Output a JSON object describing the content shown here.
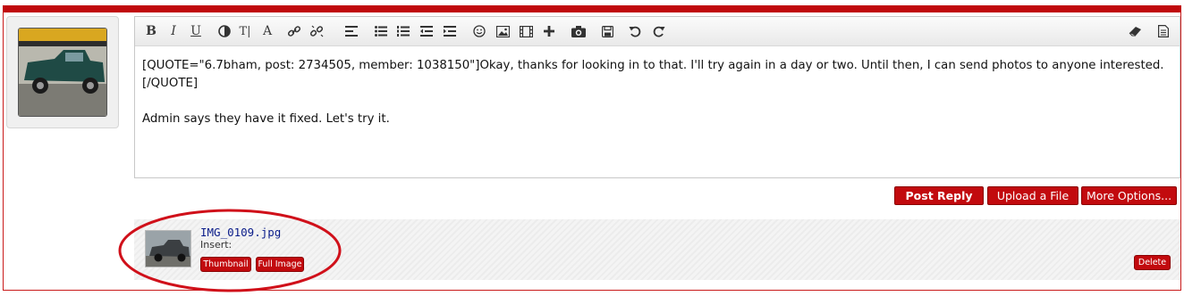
{
  "editor": {
    "toolbar": {
      "bold": "B",
      "italic": "I",
      "underline": "U",
      "text_size": "T|",
      "font": "A"
    },
    "content": {
      "line1": "[QUOTE=\"6.7bham, post: 2734505, member: 1038150\"]Okay, thanks for looking in to that. I'll try again in a day or two. Until then, I can send photos to anyone interested.",
      "line2": "[/QUOTE]",
      "line3": "Admin says they have it fixed. Let's try it."
    }
  },
  "actions": {
    "post_reply": "Post Reply",
    "upload_file": "Upload a File",
    "more_options": "More Options..."
  },
  "attachment": {
    "filename": "IMG_0109.jpg",
    "insert_label": "Insert:",
    "thumbnail_button": "Thumbnail",
    "full_image_button": "Full Image",
    "delete_button": "Delete"
  },
  "colors": {
    "accent": "#c20a0e",
    "annotation_circle": "#d0101a"
  }
}
